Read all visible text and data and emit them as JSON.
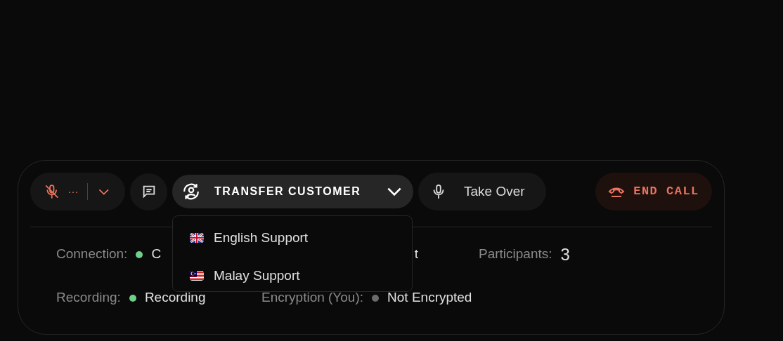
{
  "toolbar": {
    "mic": {
      "muted": true,
      "level_text": "···"
    },
    "transfer": {
      "label": "TRANSFER CUSTOMER",
      "expanded": true
    },
    "take_over": {
      "label": "Take Over"
    },
    "end_call": {
      "label": "END CALL"
    }
  },
  "transfer_menu": [
    {
      "label": "English Support",
      "kind": "uk"
    },
    {
      "label": "Malay Support",
      "kind": "my"
    }
  ],
  "stats": {
    "connection": {
      "label": "Connection:",
      "value": "C",
      "color": "#6fcf8a"
    },
    "column_2_value": "t",
    "participants": {
      "label": "Participants:",
      "value": "3"
    },
    "recording": {
      "label": "Recording:",
      "value": "Recording",
      "color": "#6fcf8a"
    },
    "encryption": {
      "label": "Encryption (You):",
      "value": "Not Encrypted",
      "color": "#6b6b6b"
    }
  }
}
